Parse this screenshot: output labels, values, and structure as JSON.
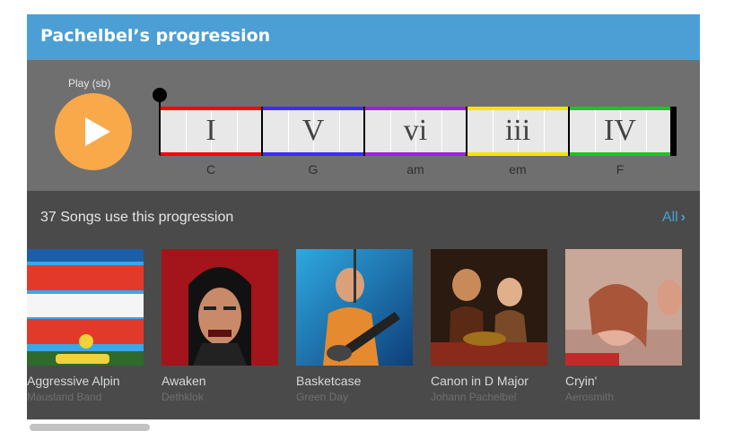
{
  "header": {
    "title": "Pachelbel’s progression"
  },
  "player": {
    "play_label": "Play (sb)",
    "chords": [
      {
        "numeral": "I",
        "name": "C",
        "color": "#ff0000"
      },
      {
        "numeral": "V",
        "name": "G",
        "color": "#3c2cff"
      },
      {
        "numeral": "vi",
        "name": "am",
        "color": "#a020e0"
      },
      {
        "numeral": "iii",
        "name": "em",
        "color": "#f4e400"
      },
      {
        "numeral": "IV",
        "name": "F",
        "color": "#1fc41f"
      }
    ]
  },
  "songs_section": {
    "heading": "37 Songs use this progression",
    "all_label": "All",
    "songs": [
      {
        "title": "Aggressive Alpin",
        "artist": "Mausland Band"
      },
      {
        "title": "Awaken",
        "artist": "Dethklok"
      },
      {
        "title": "Basketcase",
        "artist": "Green Day"
      },
      {
        "title": "Canon in D Major",
        "artist": "Johann Pachelbel"
      },
      {
        "title": "Cryin'",
        "artist": "Aerosmith"
      }
    ]
  },
  "colors": {
    "accent": "#4b9fd5",
    "play_button": "#f9a94a",
    "player_bg": "#6f6f6f",
    "list_bg": "#4a4a4a"
  }
}
